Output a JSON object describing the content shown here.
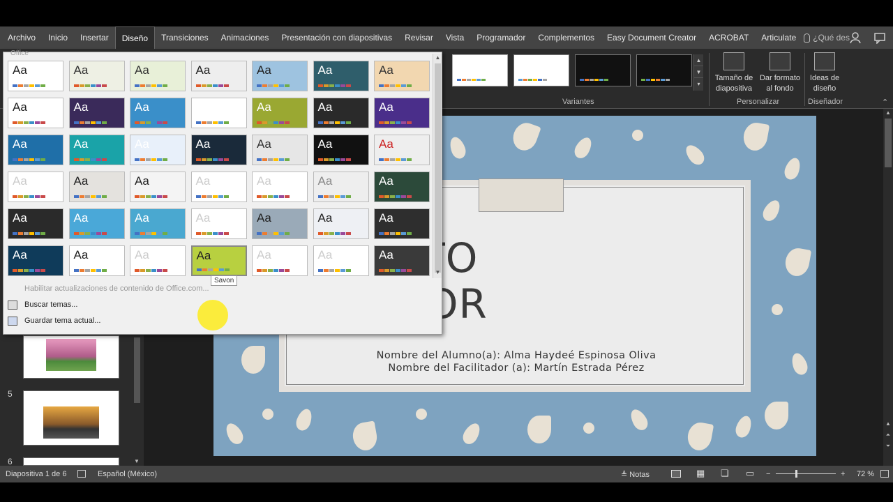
{
  "ribbon": {
    "tabs": [
      "Archivo",
      "Inicio",
      "Insertar",
      "Diseño",
      "Transiciones",
      "Animaciones",
      "Presentación con diapositivas",
      "Revisar",
      "Vista",
      "Programador",
      "Complementos",
      "Easy Document Creator",
      "ACROBAT",
      "Articulate"
    ],
    "active_tab": "Diseño",
    "tell_me": "¿Qué des",
    "groups": {
      "variants_label": "Variantes",
      "customize_label": "Personalizar",
      "designer_label": "Diseñador",
      "slide_size": "Tamaño de diapositiva",
      "format_background": "Dar formato al fondo",
      "design_ideas": "Ideas de diseño"
    }
  },
  "dropdown": {
    "section_label": "Office",
    "enable_updates": "Habilitar actualizaciones de contenido de Office.com...",
    "browse_themes": "Buscar temas...",
    "save_theme": "Guardar tema actual...",
    "tooltip": "Savon"
  },
  "slide": {
    "title_line1": "ROYECTO",
    "title_line2": "EGRADOR",
    "student": "Nombre del Alumno(a): Alma Haydeé Espinosa Oliva",
    "facilitator": "Nombre del Facilitador (a): Martín Estrada Pérez"
  },
  "thumbnails": {
    "numbers": [
      "5",
      "6"
    ]
  },
  "status": {
    "slide_counter": "Diapositiva 1 de 6",
    "language": "Español (México)",
    "notes": "Notas",
    "zoom": "72 %"
  },
  "colors": {
    "slide_bg": "#7ea3c0",
    "pattern": "#e8e1d4",
    "ribbon_dark": "#2b2b2b",
    "tab_bar": "#444444"
  }
}
